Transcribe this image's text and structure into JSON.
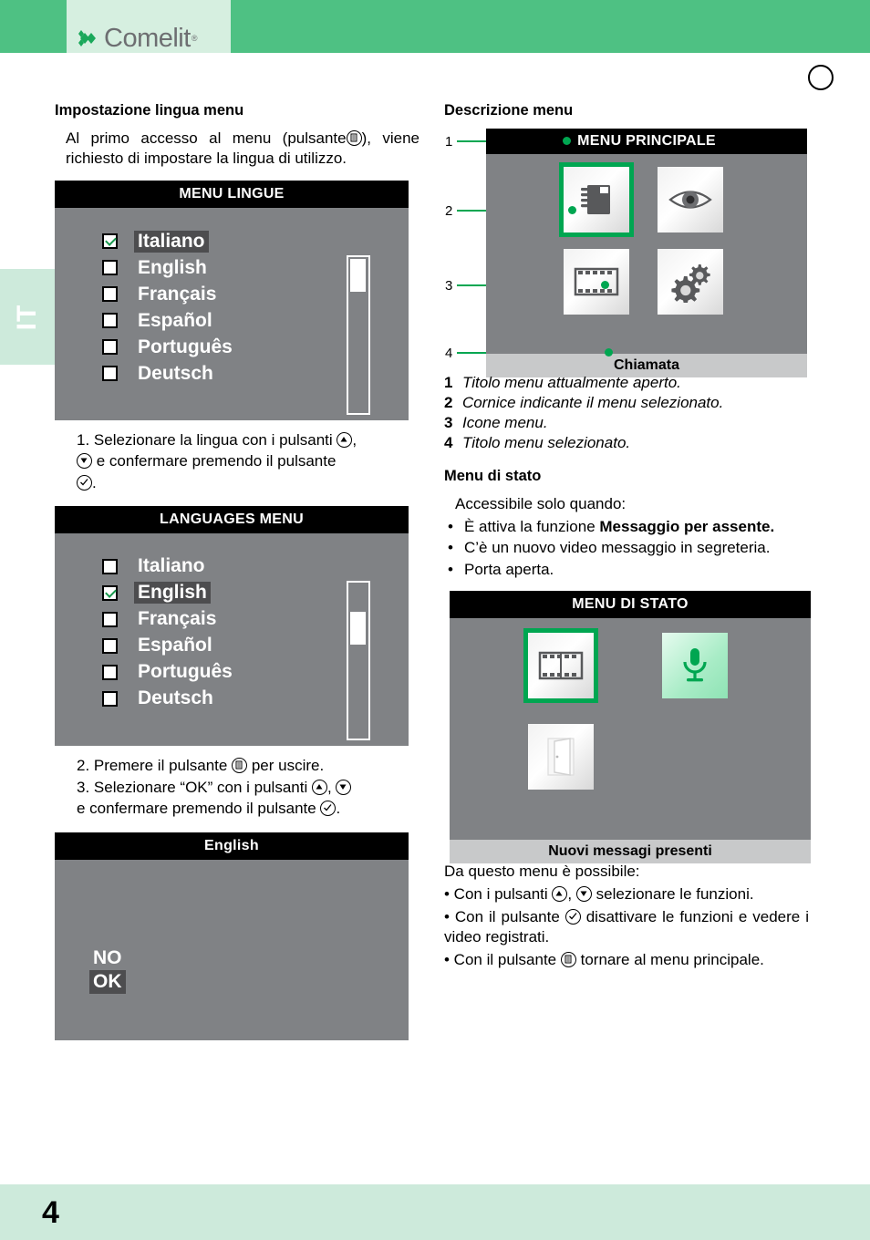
{
  "header": {
    "brand": "Comelit",
    "registered_mark": "®",
    "language_tab": "IT"
  },
  "footer": {
    "page_number": "4"
  },
  "left_column": {
    "title": "Impostazione lingua menu",
    "intro_before_icon": "Al primo accesso al menu (pulsante",
    "intro_after_icon": "), viene richiesto di impostare la lingua di utilizzo.",
    "screen_languages_it": {
      "title": "MENU LINGUE",
      "items": [
        {
          "label": "Italiano",
          "checked": true,
          "selected": true
        },
        {
          "label": "English",
          "checked": false,
          "selected": false
        },
        {
          "label": "Français",
          "checked": false,
          "selected": false
        },
        {
          "label": "Español",
          "checked": false,
          "selected": false
        },
        {
          "label": "Português",
          "checked": false,
          "selected": false
        },
        {
          "label": "Deutsch",
          "checked": false,
          "selected": false
        }
      ],
      "scroll_position": 0
    },
    "step1_a": "1. Selezionare la lingua con i pulsanti",
    "step1_b": ",",
    "step1_c": "e confermare premendo il pulsante",
    "step1_d": ".",
    "screen_languages_en": {
      "title": "LANGUAGES MENU",
      "items": [
        {
          "label": "Italiano",
          "checked": false,
          "selected": false
        },
        {
          "label": "English",
          "checked": true,
          "selected": true
        },
        {
          "label": "Français",
          "checked": false,
          "selected": false
        },
        {
          "label": "Español",
          "checked": false,
          "selected": false
        },
        {
          "label": "Português",
          "checked": false,
          "selected": false
        },
        {
          "label": "Deutsch",
          "checked": false,
          "selected": false
        }
      ],
      "scroll_position": 1
    },
    "step2_a": "2. Premere il pulsante",
    "step2_b": "per uscire.",
    "step3_a": "3. Selezionare “OK” con i pulsanti",
    "step3_b": ",",
    "step3_c": "e confermare premendo il pulsante",
    "step3_d": ".",
    "screen_confirm": {
      "title": "English",
      "option_no": "NO",
      "option_ok": "OK",
      "selected_option": "OK"
    }
  },
  "right_column": {
    "title": "Descrizione menu",
    "screen_main_menu": {
      "title": "MENU PRINCIPALE",
      "status": "Chiamata",
      "icons": [
        {
          "name": "address-book-icon",
          "selected": true
        },
        {
          "name": "eye-icon",
          "selected": false
        },
        {
          "name": "film-strip-icon",
          "selected": false
        },
        {
          "name": "gears-icon",
          "selected": false
        }
      ],
      "callouts": [
        "1",
        "2",
        "3",
        "4"
      ]
    },
    "legend": [
      {
        "num": "1",
        "text": "Titolo menu attualmente aperto."
      },
      {
        "num": "2",
        "text": "Cornice indicante il menu selezionato."
      },
      {
        "num": "3",
        "text": "Icone menu."
      },
      {
        "num": "4",
        "text": "Titolo menu selezionato."
      }
    ],
    "status_menu": {
      "title": "Menu di stato",
      "intro": "Accessibile solo quando:",
      "bullets": [
        {
          "text_before": "È attiva la funzione ",
          "bold": "Messaggio per assente.",
          "text_after": ""
        },
        {
          "text_before": "C’è un nuovo video messaggio in segreteria.",
          "bold": "",
          "text_after": ""
        },
        {
          "text_before": "Porta aperta.",
          "bold": "",
          "text_after": ""
        }
      ]
    },
    "screen_status_menu": {
      "title": "MENU DI STATO",
      "status": "Nuovi messagi presenti",
      "icons": [
        {
          "name": "film-strip-icon",
          "selected": true
        },
        {
          "name": "microphone-icon",
          "selected": false,
          "highlight": "green"
        },
        {
          "name": "door-open-icon",
          "selected": false
        }
      ]
    },
    "outro_intro": "Da questo menu è possibile:",
    "outro_b1_a": "• Con i pulsanti",
    "outro_b1_b": ",",
    "outro_b1_c": "selezionare le funzioni.",
    "outro_b2_a": "• Con il pulsante",
    "outro_b2_b": "disattivare le funzioni e vedere i video registrati.",
    "outro_b3_a": "• Con il pulsante",
    "outro_b3_b": "tornare al menu principale."
  },
  "colors": {
    "brand_green": "#4ec183",
    "tab_green": "#cdeadb",
    "screen_gray": "#808285",
    "accent_green": "#00a651",
    "selection_gray": "#4d4d4f"
  }
}
